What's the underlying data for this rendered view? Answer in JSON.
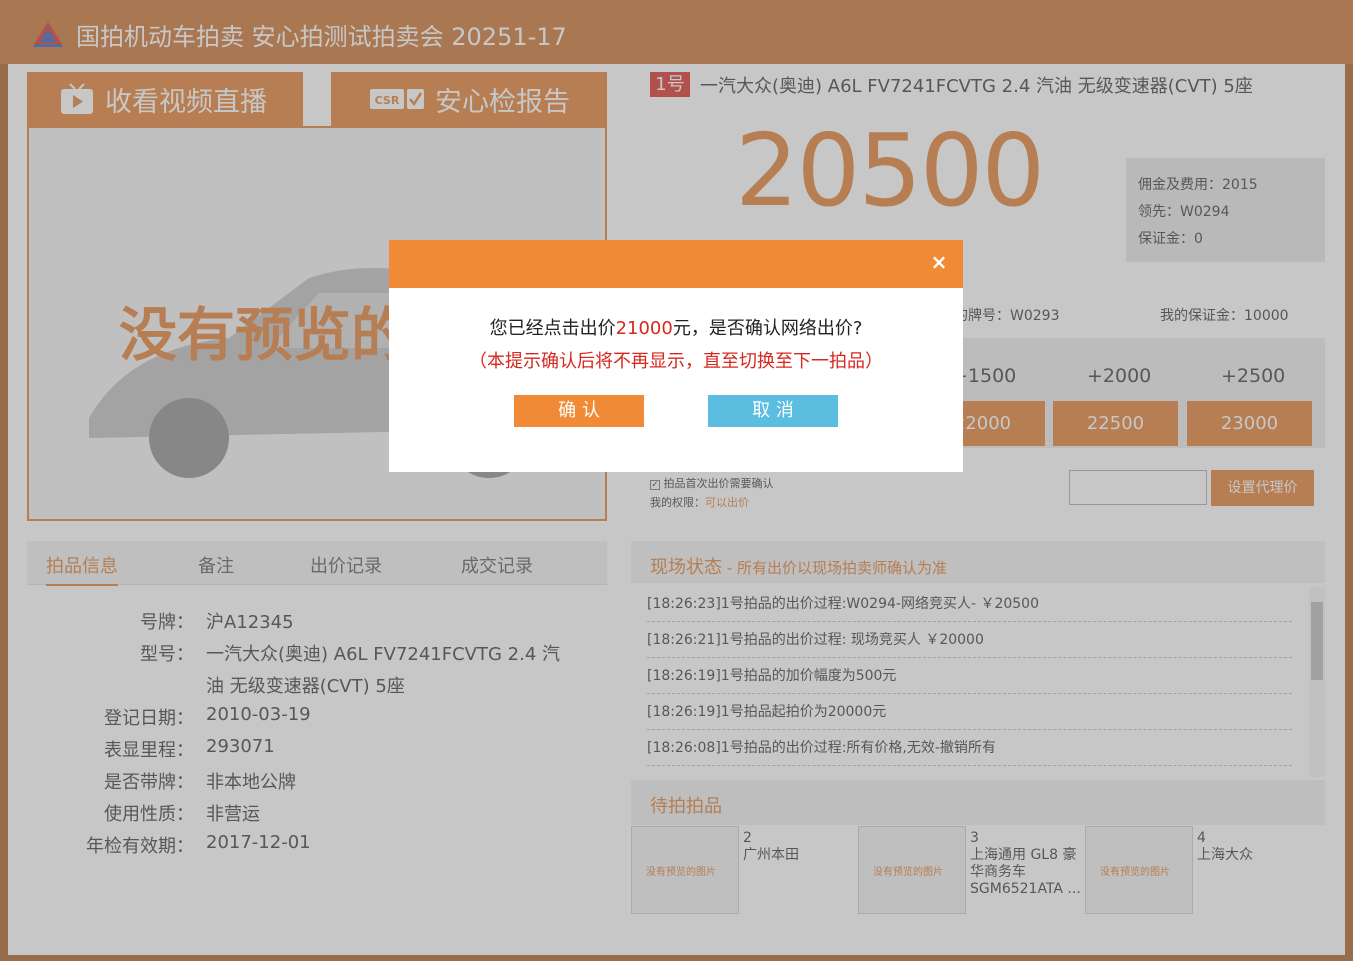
{
  "header": {
    "title": "国拍机动车拍卖  安心拍测试拍卖会 20251-17"
  },
  "left_tabs": {
    "video": "收看视频直播",
    "report": "安心检报告",
    "report_logo": "CSR"
  },
  "preview": {
    "text": "没有预览的图片"
  },
  "lot": {
    "badge": "1号",
    "title": "一汽大众(奥迪) A6L FV7241FCVTG 2.4 汽油 无级变速器(CVT) 5座",
    "price": "20500"
  },
  "fees": {
    "commission": "佣金及费用：2015",
    "leader": "领先：W0294",
    "deposit": "保证金：0"
  },
  "bidder": {
    "number": "我的牌号：W0293",
    "my_deposit": "我的保证金：10000"
  },
  "increments": [
    "+1500",
    "+2000",
    "+2500"
  ],
  "bids": [
    "22000",
    "22500",
    "23000"
  ],
  "options": {
    "confirm_first": "拍品首次出价需要确认",
    "rights_label": "我的权限：",
    "rights_value": "可以出价"
  },
  "proxy": {
    "button": "设置代理价",
    "value": ""
  },
  "info_tabs": [
    "拍品信息",
    "备注",
    "出价记录",
    "成交记录"
  ],
  "fields": [
    {
      "k": "号牌：",
      "v": "沪A12345"
    },
    {
      "k": "型号：",
      "v": "一汽大众(奥迪) A6L FV7241FCVTG 2.4 汽",
      "v2": "油 无级变速器(CVT) 5座"
    },
    {
      "k": "登记日期：",
      "v": "2010-03-19"
    },
    {
      "k": "表显里程：",
      "v": "293071"
    },
    {
      "k": "是否带牌：",
      "v": "非本地公牌"
    },
    {
      "k": "使用性质：",
      "v": "非营运"
    },
    {
      "k": "年检有效期：",
      "v": "2017-12-01"
    }
  ],
  "status": {
    "title": "现场状态",
    "subtitle": " - 所有出价以现场拍卖师确认为准",
    "logs": [
      "[18:26:23]1号拍品的出价过程:W0294-网络竞买人- ￥20500",
      "[18:26:21]1号拍品的出价过程: 现场竞买人 ￥20000",
      "[18:26:19]1号拍品的加价幅度为500元",
      "[18:26:19]1号拍品起拍价为20000元",
      "[18:26:08]1号拍品的出价过程:所有价格,无效-撤销所有"
    ]
  },
  "pending": {
    "title": "待拍拍品",
    "thumb_text": "没有预览的图片",
    "items": [
      {
        "num": "2",
        "name": "广州本田"
      },
      {
        "num": "3",
        "name": "上海通用 GL8 豪华商务车 SGM6521ATA ..."
      },
      {
        "num": "4",
        "name": "上海大众"
      }
    ]
  },
  "modal": {
    "close": "×",
    "q_prefix": "您已经点击出价",
    "q_amount": "21000",
    "q_suffix": "元，是否确认网络出价?",
    "warning": "（本提示确认后将不再显示，直至切换至下一拍品）",
    "confirm": "确 认",
    "cancel": "取 消"
  },
  "colors": {
    "brand": "#e07a2a",
    "header": "#c8702a",
    "alert": "#d7271f",
    "cancel": "#5bbde0",
    "modal_bar": "#f08a36"
  }
}
